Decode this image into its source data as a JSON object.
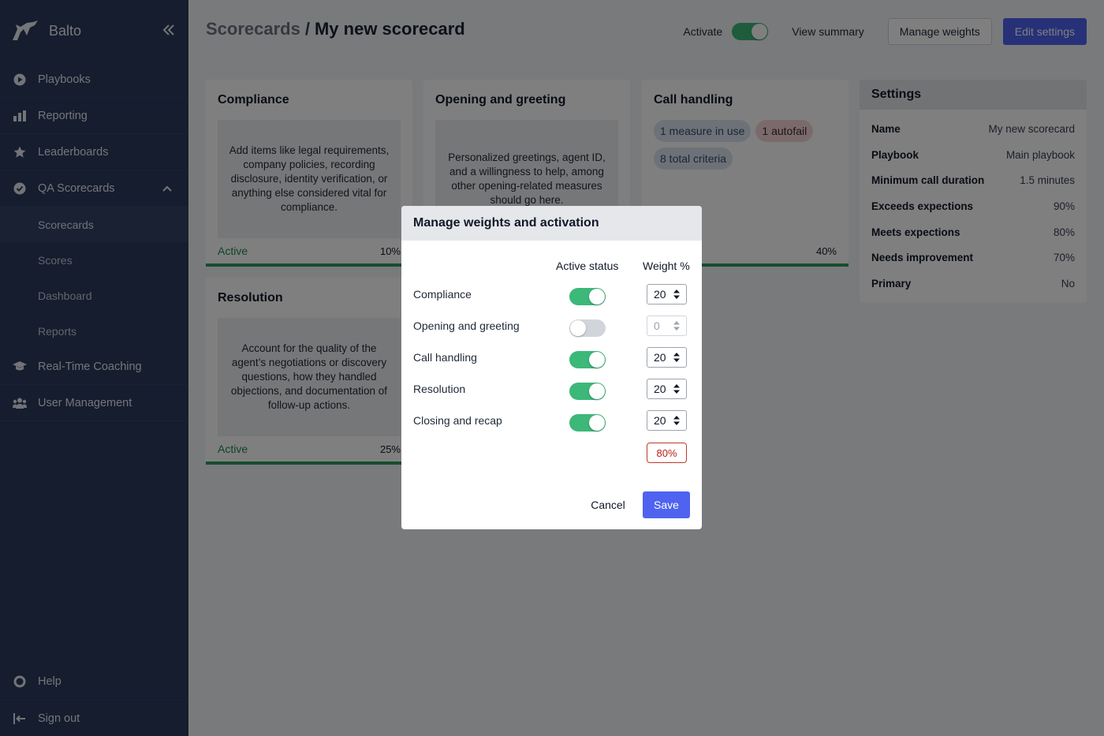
{
  "app": {
    "name": "Balto"
  },
  "sidebar": {
    "items": [
      {
        "label": "Playbooks",
        "icon": "play-circle-icon"
      },
      {
        "label": "Reporting",
        "icon": "bar-chart-icon"
      },
      {
        "label": "Leaderboards",
        "icon": "star-icon"
      },
      {
        "label": "QA Scorecards",
        "icon": "check-circle-icon",
        "expanded": true
      }
    ],
    "sub_items": [
      {
        "label": "Scorecards",
        "active": true
      },
      {
        "label": "Scores"
      },
      {
        "label": "Dashboard"
      },
      {
        "label": "Reports"
      }
    ],
    "items_after": [
      {
        "label": "Real-Time Coaching",
        "icon": "graduation-cap-icon"
      },
      {
        "label": "User Management",
        "icon": "users-icon"
      }
    ],
    "bottom": [
      {
        "label": "Help",
        "icon": "lifebuoy-icon"
      },
      {
        "label": "Sign out",
        "icon": "sign-out-icon"
      }
    ]
  },
  "header": {
    "breadcrumb": "Scorecards",
    "separator": "/",
    "title": "My new scorecard",
    "activate_label": "Activate",
    "activate_on": true,
    "view_summary": "View summary",
    "manage_weights": "Manage weights",
    "edit_settings": "Edit settings"
  },
  "cards": {
    "compliance": {
      "title": "Compliance",
      "description": "Add items like legal requirements, company policies, recording disclosure, identity verification, or anything else considered vital for compliance.",
      "status": "Active",
      "percent": "10%"
    },
    "opening": {
      "title": "Opening and greeting",
      "description": "Personalized greetings, agent ID, and a willingness to help, among other opening-related measures should go here."
    },
    "call_handling": {
      "title": "Call handling",
      "pills": [
        "1 measure in use",
        "1 autofail",
        "8 total criteria"
      ],
      "percent": "40%"
    },
    "resolution": {
      "title": "Resolution",
      "description": "Account for the quality of the agent’s negotiations or discovery questions, how they handled objections, and documentation of follow-up actions.",
      "status": "Active",
      "percent": "25%"
    }
  },
  "settings": {
    "title": "Settings",
    "rows": [
      {
        "key": "Name",
        "value": "My new scorecard"
      },
      {
        "key": "Playbook",
        "value": "Main playbook"
      },
      {
        "key": "Minimum call duration",
        "value": "1.5 minutes"
      },
      {
        "key": "Exceeds expections",
        "value": "90%"
      },
      {
        "key": "Meets expections",
        "value": "80%"
      },
      {
        "key": "Needs improvement",
        "value": "70%"
      },
      {
        "key": "Primary",
        "value": "No"
      }
    ]
  },
  "modal": {
    "title": "Manage weights and activation",
    "col_active": "Active status",
    "col_weight": "Weight %",
    "rows": [
      {
        "label": "Compliance",
        "active": true,
        "weight": "20"
      },
      {
        "label": "Opening and greeting",
        "active": false,
        "weight": "0"
      },
      {
        "label": "Call handling",
        "active": true,
        "weight": "20"
      },
      {
        "label": "Resolution",
        "active": true,
        "weight": "20"
      },
      {
        "label": "Closing and recap",
        "active": true,
        "weight": "20"
      }
    ],
    "total": "80%",
    "cancel": "Cancel",
    "save": "Save"
  },
  "colors": {
    "sidebar_bg": "#2a3a5c",
    "primary": "#4f63f0",
    "toggle_on": "#3cb878",
    "active_text": "#1f8a4c",
    "error": "#c0392b"
  }
}
